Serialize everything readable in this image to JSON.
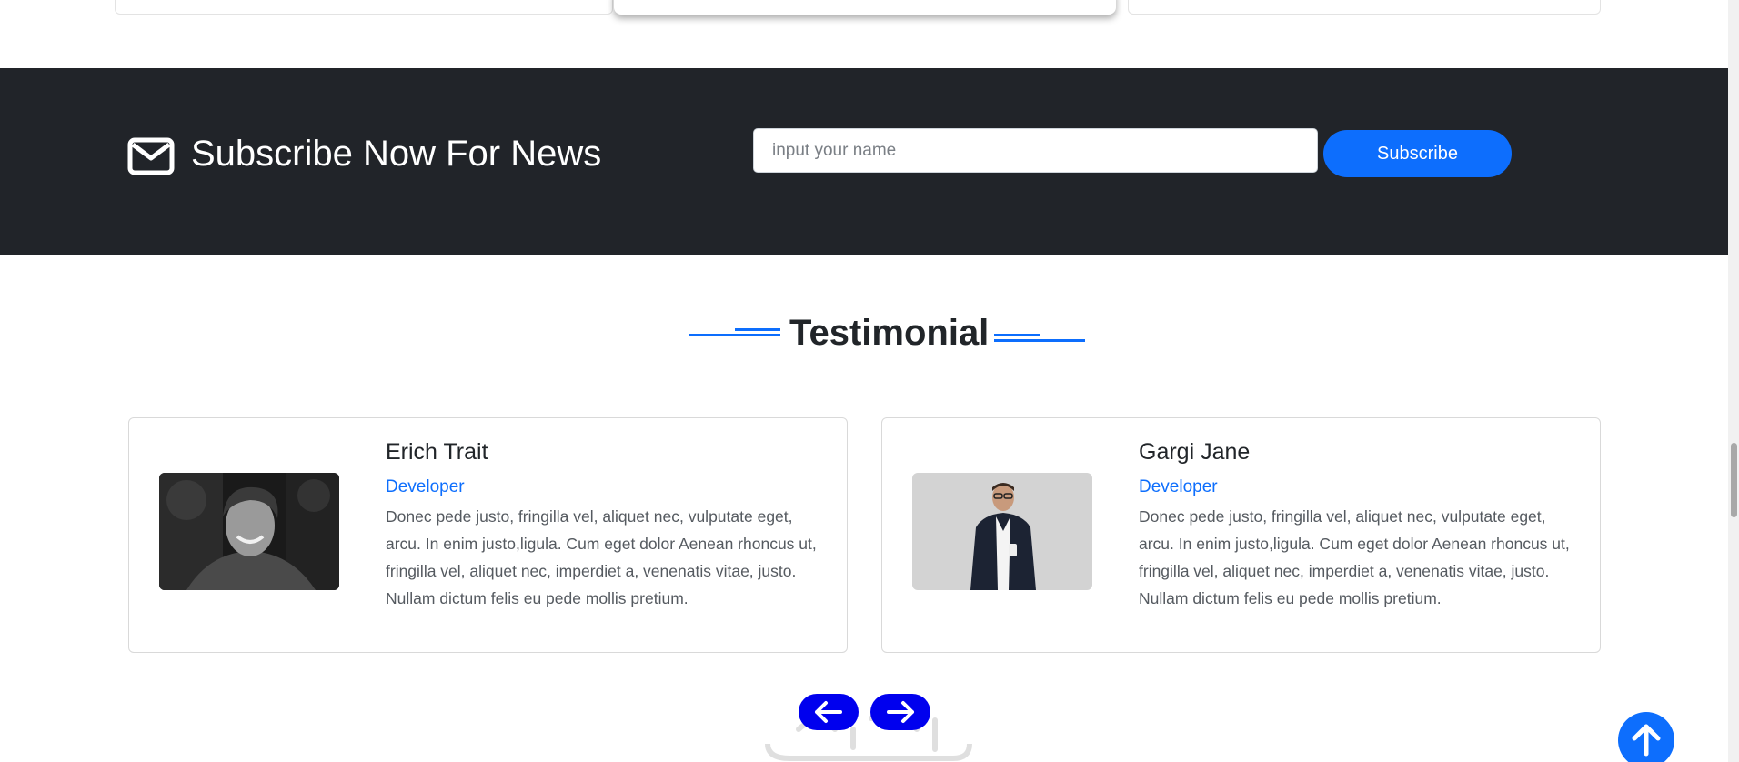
{
  "subscribe": {
    "title": "Subscribe Now For News",
    "placeholder": "input your name",
    "button_label": "Subscribe"
  },
  "testimonial": {
    "title": "Testimonial",
    "cards": [
      {
        "name": "Erich Trait",
        "role": "Developer",
        "text": "Donec pede justo, fringilla vel, aliquet nec, vulputate eget, arcu. In enim justo,ligula. Cum eget dolor Aenean rhoncus ut, fringilla vel, aliquet nec, imperdiet a, venenatis vitae, justo. Nullam dictum felis eu pede mollis pretium."
      },
      {
        "name": "Gargi Jane",
        "role": "Developer",
        "text": "Donec pede justo, fringilla vel, aliquet nec, vulputate eget, arcu. In enim justo,ligula. Cum eget dolor Aenean rhoncus ut, fringilla vel, aliquet nec, imperdiet a, venenatis vitae, justo. Nullam dictum felis eu pede mollis pretium."
      }
    ]
  },
  "controls": {
    "prev_icon": "arrow-left-icon",
    "next_icon": "arrow-right-icon",
    "to_top_icon": "arrow-up-icon"
  },
  "colors": {
    "accent": "#0d6efd",
    "dark_band": "#212429",
    "nav_button": "#0000ee"
  }
}
